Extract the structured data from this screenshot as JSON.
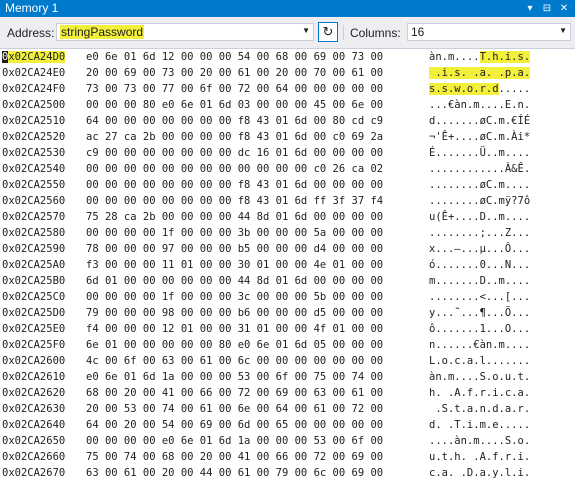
{
  "window": {
    "title": "Memory 1",
    "controls": [
      "▾",
      "⊟",
      "✕"
    ]
  },
  "toolbar": {
    "address_label": "Address:",
    "address_value": "stringPassword",
    "refresh_glyph": "↻",
    "columns_label": "Columns:",
    "columns_value": "16"
  },
  "rows": [
    {
      "addr": "0x02CA24D0",
      "hex": "e0 6e 01 6d 12 00 00 00 54 00 68 00 69 00 73 00",
      "ascii": "àn.m....T.h.i.s."
    },
    {
      "addr": "0x02CA24E0",
      "hex": "20 00 69 00 73 00 20 00 61 00 20 00 70 00 61 00",
      "ascii": " .i.s. .a. .p.a."
    },
    {
      "addr": "0x02CA24F0",
      "hex": "73 00 73 00 77 00 6f 00 72 00 64 00 00 00 00 00",
      "ascii": "s.s.w.o.r.d....."
    },
    {
      "addr": "0x02CA2500",
      "hex": "00 00 00 80 e0 6e 01 6d 03 00 00 00 45 00 6e 00",
      "ascii": "...€àn.m....E.n."
    },
    {
      "addr": "0x02CA2510",
      "hex": "64 00 00 00 00 00 00 00 f8 43 01 6d 00 80 cd c9",
      "ascii": "d.......øC.m.€ÍÉ"
    },
    {
      "addr": "0x02CA2520",
      "hex": "ac 27 ca 2b 00 00 00 00 f8 43 01 6d 00 c0 69 2a",
      "ascii": "¬'Ê+....øC.m.Ài*"
    },
    {
      "addr": "0x02CA2530",
      "hex": "c9 00 00 00 00 00 00 00 dc 16 01 6d 00 00 00 00",
      "ascii": "É.......Ü..m...."
    },
    {
      "addr": "0x02CA2540",
      "hex": "00 00 00 00 00 00 00 00 00 00 00 00 c0 26 ca 02",
      "ascii": "............À&Ê."
    },
    {
      "addr": "0x02CA2550",
      "hex": "00 00 00 00 00 00 00 00 f8 43 01 6d 00 00 00 00",
      "ascii": "........øC.m...."
    },
    {
      "addr": "0x02CA2560",
      "hex": "00 00 00 00 00 00 00 00 f8 43 01 6d ff 3f 37 f4",
      "ascii": "........øC.mÿ?7ô"
    },
    {
      "addr": "0x02CA2570",
      "hex": "75 28 ca 2b 00 00 00 00 44 8d 01 6d 00 00 00 00",
      "ascii": "u(Ê+....D..m...."
    },
    {
      "addr": "0x02CA2580",
      "hex": "00 00 00 00 1f 00 00 00 3b 00 00 00 5a 00 00 00",
      "ascii": "........;...Z..."
    },
    {
      "addr": "0x02CA2590",
      "hex": "78 00 00 00 97 00 00 00 b5 00 00 00 d4 00 00 00",
      "ascii": "x...—...µ...Ô..."
    },
    {
      "addr": "0x02CA25A0",
      "hex": "f3 00 00 00 11 01 00 00 30 01 00 00 4e 01 00 00",
      "ascii": "ó.......0...N..."
    },
    {
      "addr": "0x02CA25B0",
      "hex": "6d 01 00 00 00 00 00 00 44 8d 01 6d 00 00 00 00",
      "ascii": "m.......D..m...."
    },
    {
      "addr": "0x02CA25C0",
      "hex": "00 00 00 00 1f 00 00 00 3c 00 00 00 5b 00 00 00",
      "ascii": "........<...[..."
    },
    {
      "addr": "0x02CA25D0",
      "hex": "79 00 00 00 98 00 00 00 b6 00 00 00 d5 00 00 00",
      "ascii": "y...˜...¶...Õ..."
    },
    {
      "addr": "0x02CA25E0",
      "hex": "f4 00 00 00 12 01 00 00 31 01 00 00 4f 01 00 00",
      "ascii": "ô.......1...O..."
    },
    {
      "addr": "0x02CA25F0",
      "hex": "6e 01 00 00 00 00 00 80 e0 6e 01 6d 05 00 00 00",
      "ascii": "n......€àn.m...."
    },
    {
      "addr": "0x02CA2600",
      "hex": "4c 00 6f 00 63 00 61 00 6c 00 00 00 00 00 00 00",
      "ascii": "L.o.c.a.l......."
    },
    {
      "addr": "0x02CA2610",
      "hex": "e0 6e 01 6d 1a 00 00 00 53 00 6f 00 75 00 74 00",
      "ascii": "àn.m....S.o.u.t."
    },
    {
      "addr": "0x02CA2620",
      "hex": "68 00 20 00 41 00 66 00 72 00 69 00 63 00 61 00",
      "ascii": "h. .A.f.r.i.c.a."
    },
    {
      "addr": "0x02CA2630",
      "hex": "20 00 53 00 74 00 61 00 6e 00 64 00 61 00 72 00",
      "ascii": " .S.t.a.n.d.a.r."
    },
    {
      "addr": "0x02CA2640",
      "hex": "64 00 20 00 54 00 69 00 6d 00 65 00 00 00 00 00",
      "ascii": "d. .T.i.m.e....."
    },
    {
      "addr": "0x02CA2650",
      "hex": "00 00 00 00 e0 6e 01 6d 1a 00 00 00 53 00 6f 00",
      "ascii": "....àn.m....S.o."
    },
    {
      "addr": "0x02CA2660",
      "hex": "75 00 74 00 68 00 20 00 41 00 66 00 72 00 69 00",
      "ascii": "u.t.h. .A.f.r.i."
    },
    {
      "addr": "0x02CA2670",
      "hex": "63 00 61 00 20 00 44 00 61 00 79 00 6c 00 69 00",
      "ascii": "c.a. .D.a.y.l.i."
    }
  ],
  "highlight": {
    "color": "#f2f03b",
    "address_row": 0,
    "ascii_ranges": [
      {
        "row": 0,
        "start": 8,
        "end": 16
      },
      {
        "row": 1,
        "start": 0,
        "end": 16
      },
      {
        "row": 2,
        "start": 0,
        "end": 11
      }
    ]
  },
  "colors": {
    "accent": "#007acc",
    "toolbar_bg": "#eeeef2",
    "text": "#1e1e1e"
  }
}
